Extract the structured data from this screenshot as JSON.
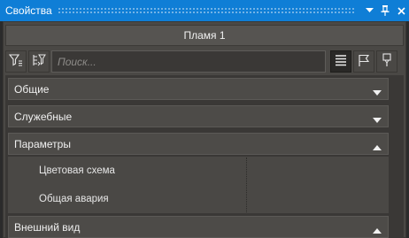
{
  "window": {
    "title": "Свойства",
    "buttons": [
      "chevron-down-icon",
      "pin-icon",
      "close-icon"
    ]
  },
  "object": {
    "name": "Пламя 1"
  },
  "toolbar": {
    "left_buttons": [
      "filter-icon",
      "filter-reset-icon"
    ],
    "search_placeholder": "Поиск...",
    "right_buttons": [
      "list-view-icon",
      "flag-icon",
      "marker-icon"
    ]
  },
  "sections": [
    {
      "label": "Общие",
      "expanded": false
    },
    {
      "label": "Служебные",
      "expanded": false
    },
    {
      "label": "Параметры",
      "expanded": true,
      "properties": [
        {
          "name": "Цветовая схема",
          "value": ""
        },
        {
          "name": "Общая авария",
          "value": ""
        }
      ]
    },
    {
      "label": "Внешний вид",
      "expanded": true
    }
  ],
  "colors": {
    "titlebar": "#0f7ed6",
    "panel": "#4a4845",
    "text": "#e0e0e0"
  }
}
